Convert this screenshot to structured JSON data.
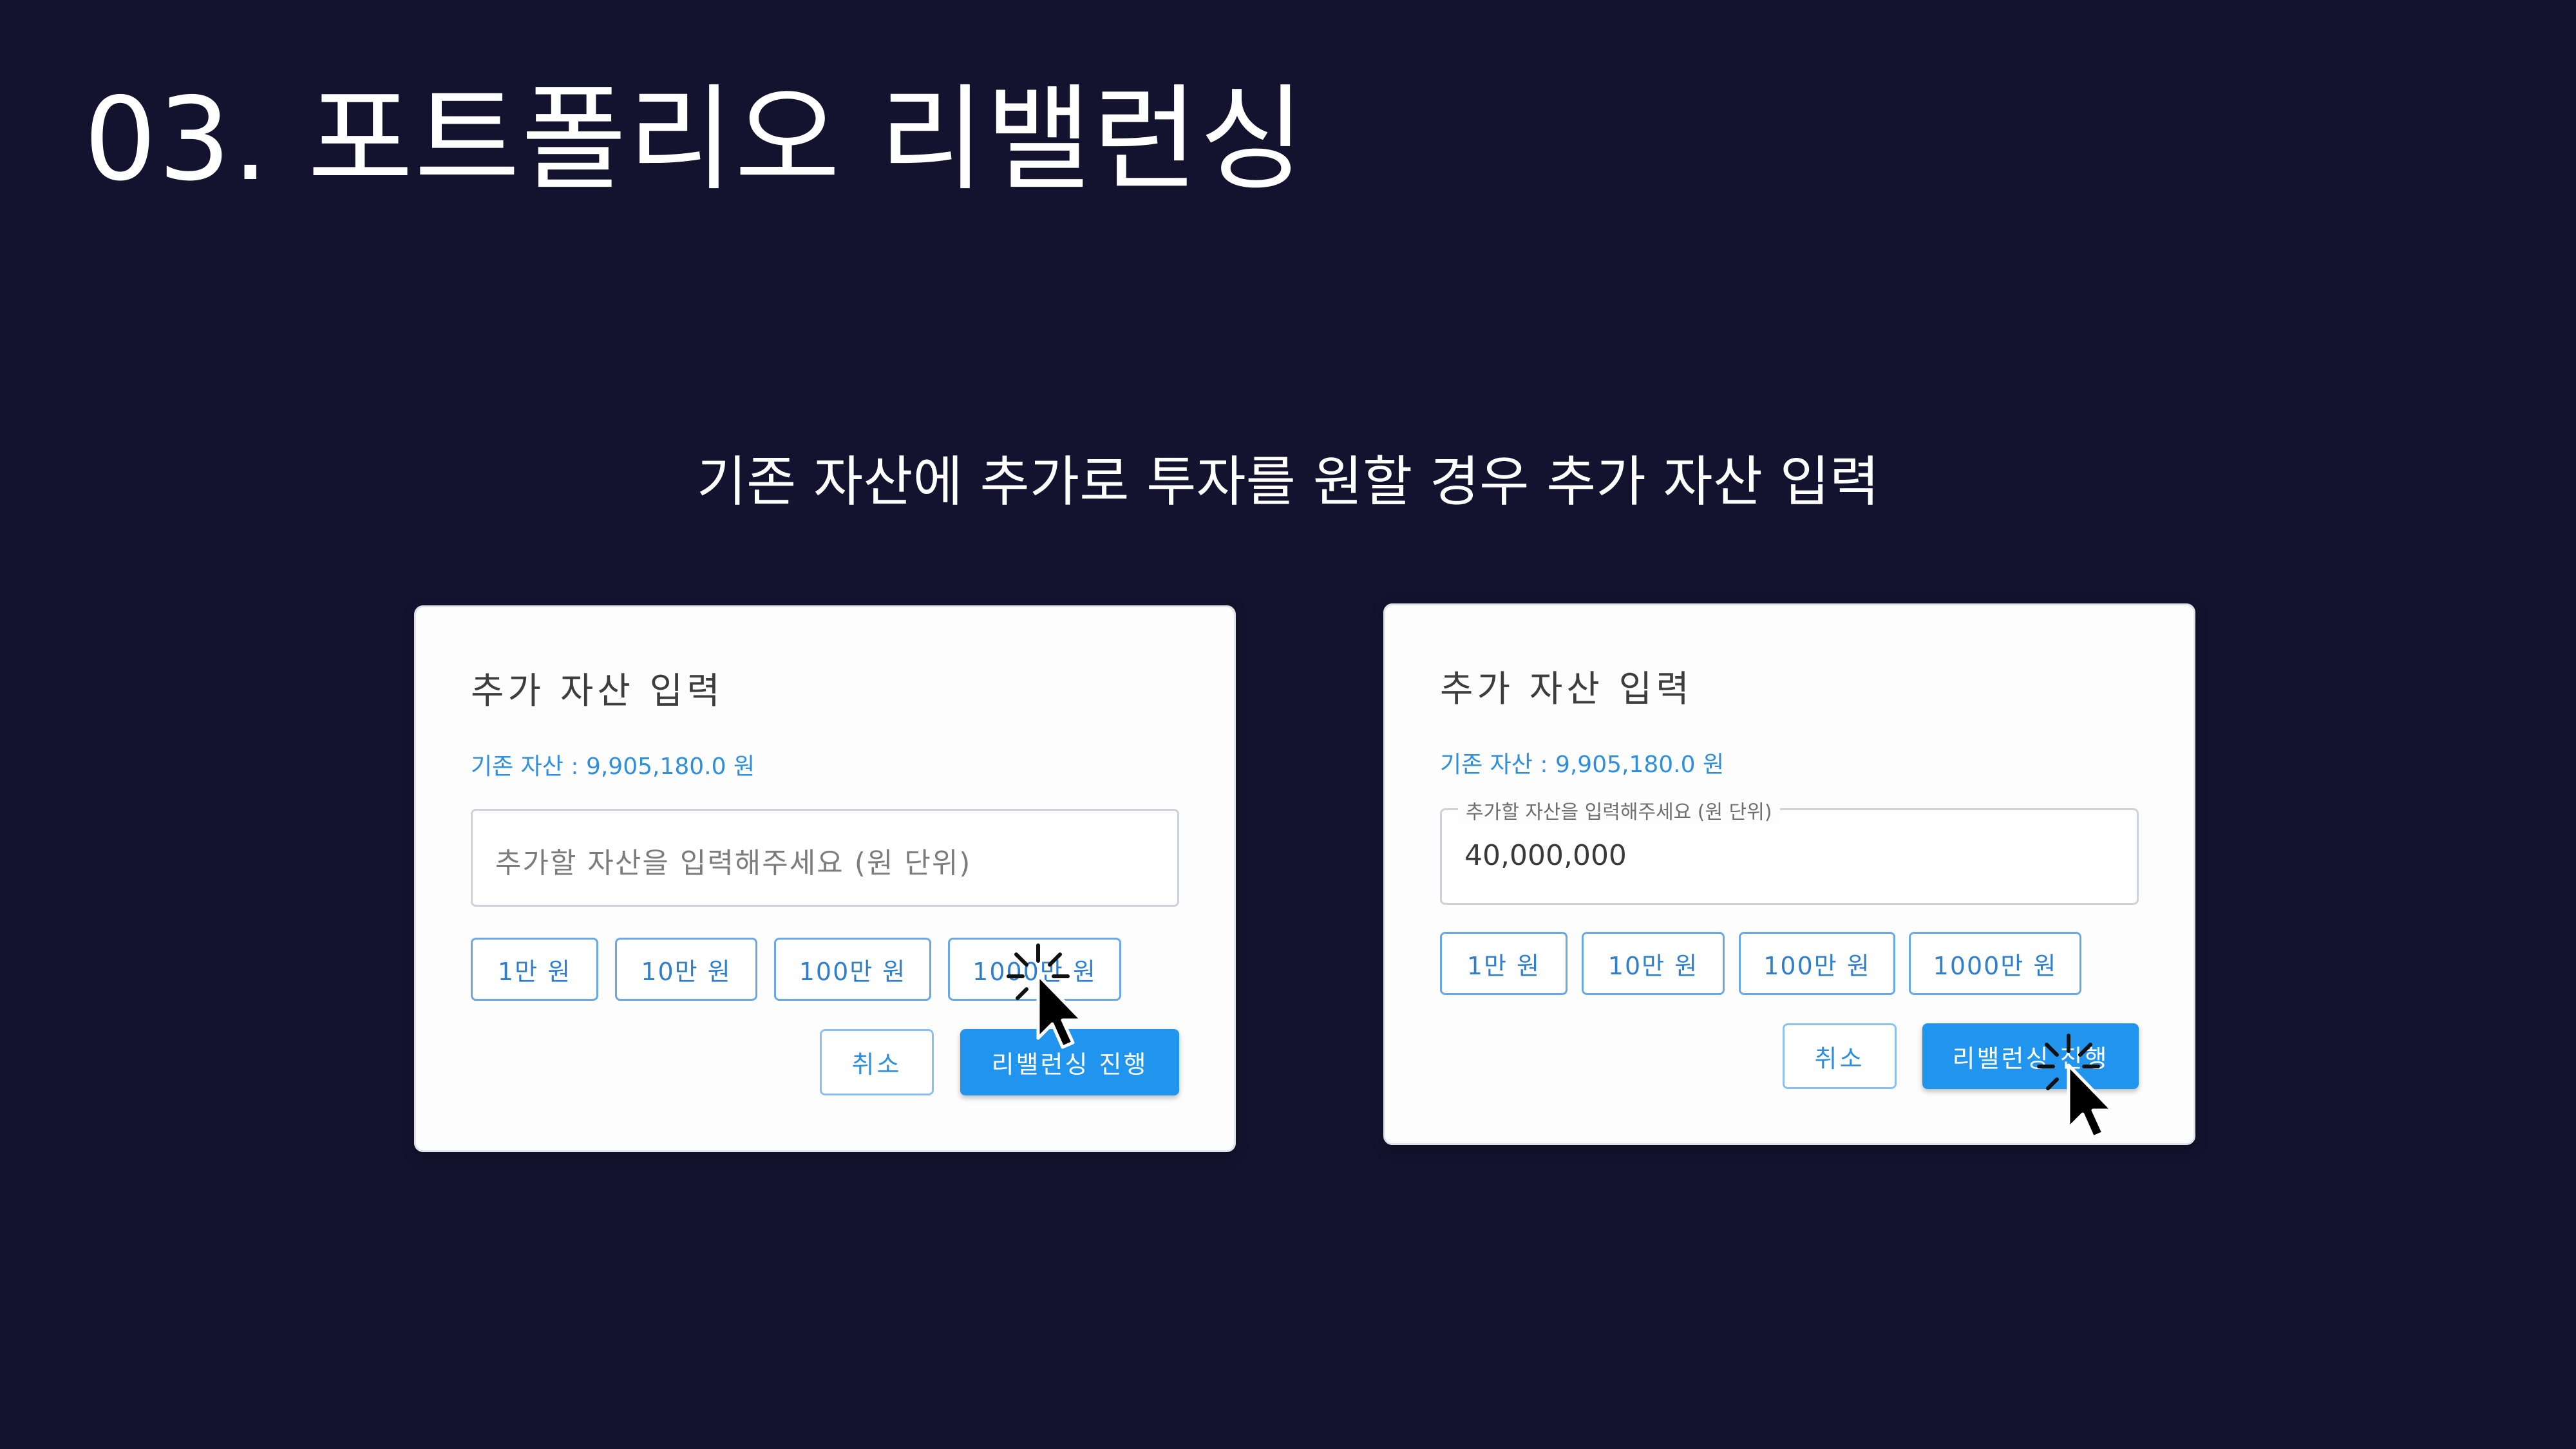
{
  "slide": {
    "title": "03. 포트폴리오 리밸런싱",
    "subtitle": "기존 자산에 추가로 투자를 원할 경우 추가 자산 입력"
  },
  "dialog_left": {
    "title": "추가 자산 입력",
    "existing_assets": "기존 자산 : 9,905,180.0 원",
    "input_placeholder": "추가할 자산을 입력해주세요 (원 단위)",
    "amount_buttons": [
      "1만 원",
      "10만 원",
      "100만 원",
      "1000만 원"
    ],
    "cancel_label": "취소",
    "submit_label": "리밸런싱 진행"
  },
  "dialog_right": {
    "title": "추가 자산 입력",
    "existing_assets": "기존 자산 : 9,905,180.0 원",
    "input_label": "추가할 자산을 입력해주세요 (원 단위)",
    "input_value": "40,000,000",
    "amount_buttons": [
      "1만 원",
      "10만 원",
      "100만 원",
      "1000만 원"
    ],
    "cancel_label": "취소",
    "submit_label": "리밸런싱 진행"
  },
  "icons": {
    "cursor": "pointer-click-icon"
  },
  "colors": {
    "background": "#14132f",
    "accent": "#2194ee"
  }
}
